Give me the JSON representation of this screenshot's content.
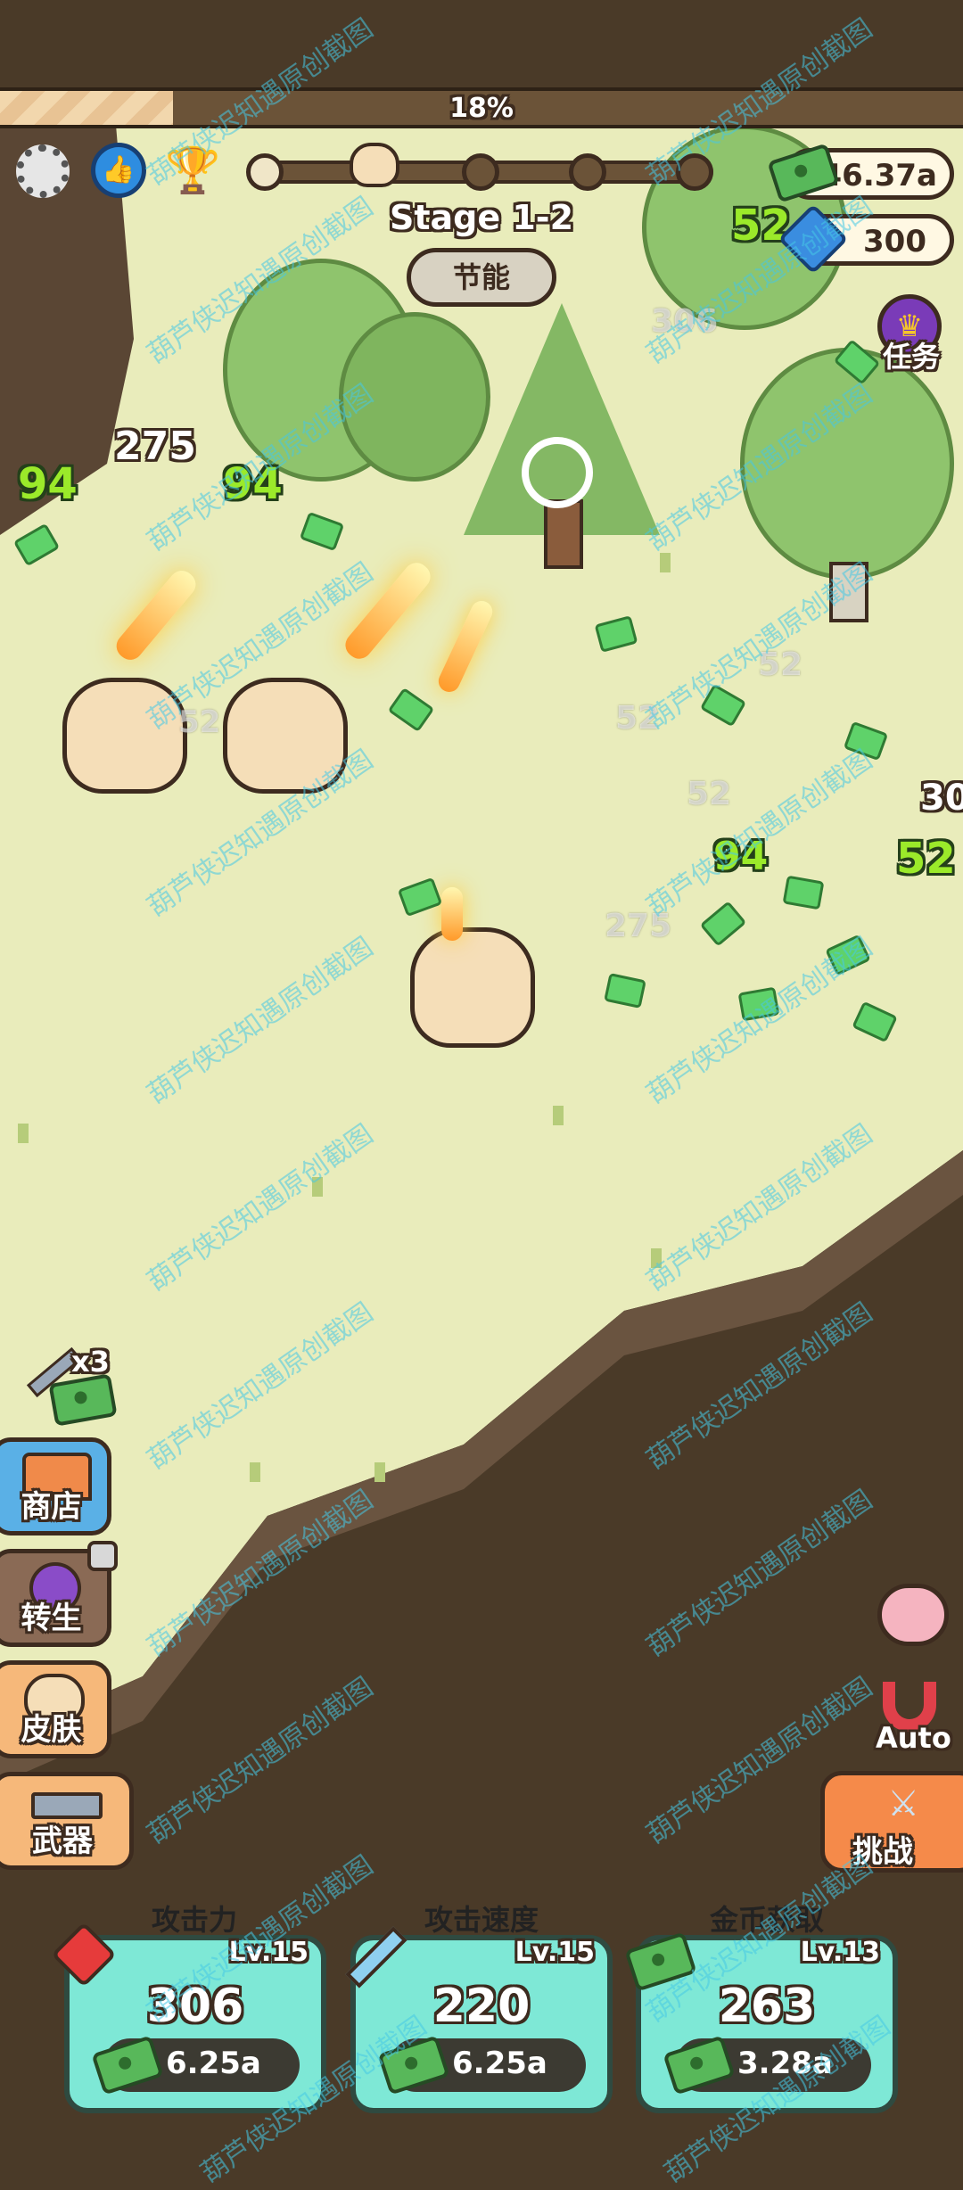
{
  "progress": {
    "percent_label": "18%",
    "value": 0.18
  },
  "hud": {
    "currency": "46.37a",
    "gems": "300",
    "stage": "Stage 1-2",
    "energy_button": "节能",
    "quest_label": "任务"
  },
  "floating_numbers": {
    "n1": "275",
    "n2": "94",
    "n3": "94",
    "n4": "52",
    "n5": "306",
    "n6": "52",
    "n7": "52",
    "n8": "52",
    "n9": "94",
    "n10": "52",
    "n11": "275",
    "n12": "30",
    "n13": "94",
    "n14": "52"
  },
  "side_menu": {
    "bonus": "x3",
    "shop": "商店",
    "rebirth": "转生",
    "skin": "皮肤",
    "weapon": "武器"
  },
  "right_menu": {
    "auto": "Auto",
    "challenge": "挑战"
  },
  "upgrades": [
    {
      "title": "攻击力",
      "level": "Lv.15",
      "value": "306",
      "cost": "6.25a"
    },
    {
      "title": "攻击速度",
      "level": "Lv.15",
      "value": "220",
      "cost": "6.25a"
    },
    {
      "title": "金币获取",
      "level": "Lv.13",
      "value": "263",
      "cost": "3.28a"
    }
  ],
  "watermark": "葫芦侠迟知遇原创截图",
  "colors": {
    "accent": "#7ee8d6",
    "orange": "#f7a259",
    "grass": "#e8ecb8",
    "cliff": "#4a3a28"
  }
}
